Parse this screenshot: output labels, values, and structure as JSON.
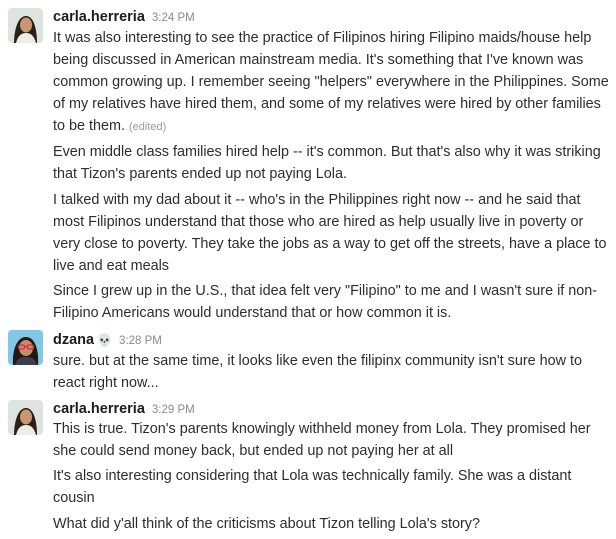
{
  "messages": [
    {
      "sender": "carla.herreria",
      "time": "3:24 PM",
      "paragraphs": [
        "It was also interesting to see the practice of Filipinos hiring Filipino maids/house help being discussed in American mainstream media. It's something that I've known was common growing up. I remember seeing \"helpers\" everywhere in the Philippines. Some of my relatives have hired them, and some of my relatives were hired by other families to be them.",
        "Even middle class families hired help -- it's common. But that's also why it was striking that Tizon's parents ended up not paying Lola.",
        "I talked with my dad about it -- who's in the Philippines right now -- and he said that most Filipinos understand that those who are hired as help usually live in poverty or very close to poverty. They take the jobs as a way to get off the streets, have a place to live and eat meals",
        "Since I grew up in the U.S., that idea felt very \"Filipino\" to me and I wasn't sure if non-Filipino Americans would understand that or how common it is."
      ],
      "edited_label": "(edited)"
    },
    {
      "sender": "dzana",
      "status_icon": "skull-icon",
      "time": "3:28 PM",
      "paragraphs": [
        "sure. but at the same time, it looks like even the filipinx community isn't sure how to react right now..."
      ]
    },
    {
      "sender": "carla.herreria",
      "time": "3:29 PM",
      "paragraphs": [
        "This is true. Tizon's parents knowingly withheld money from Lola. They promised her she could send money back, but ended up not paying her at all",
        "It's also interesting considering that Lola was technically family. She was a distant cousin",
        "What did y'all think of the criticisms about Tizon telling Lola's story?"
      ]
    }
  ],
  "colors": {
    "name": "#1d1c1d",
    "text": "#2c2d30",
    "timestamp": "#8a8a8a",
    "edited": "#9a9a9a"
  }
}
